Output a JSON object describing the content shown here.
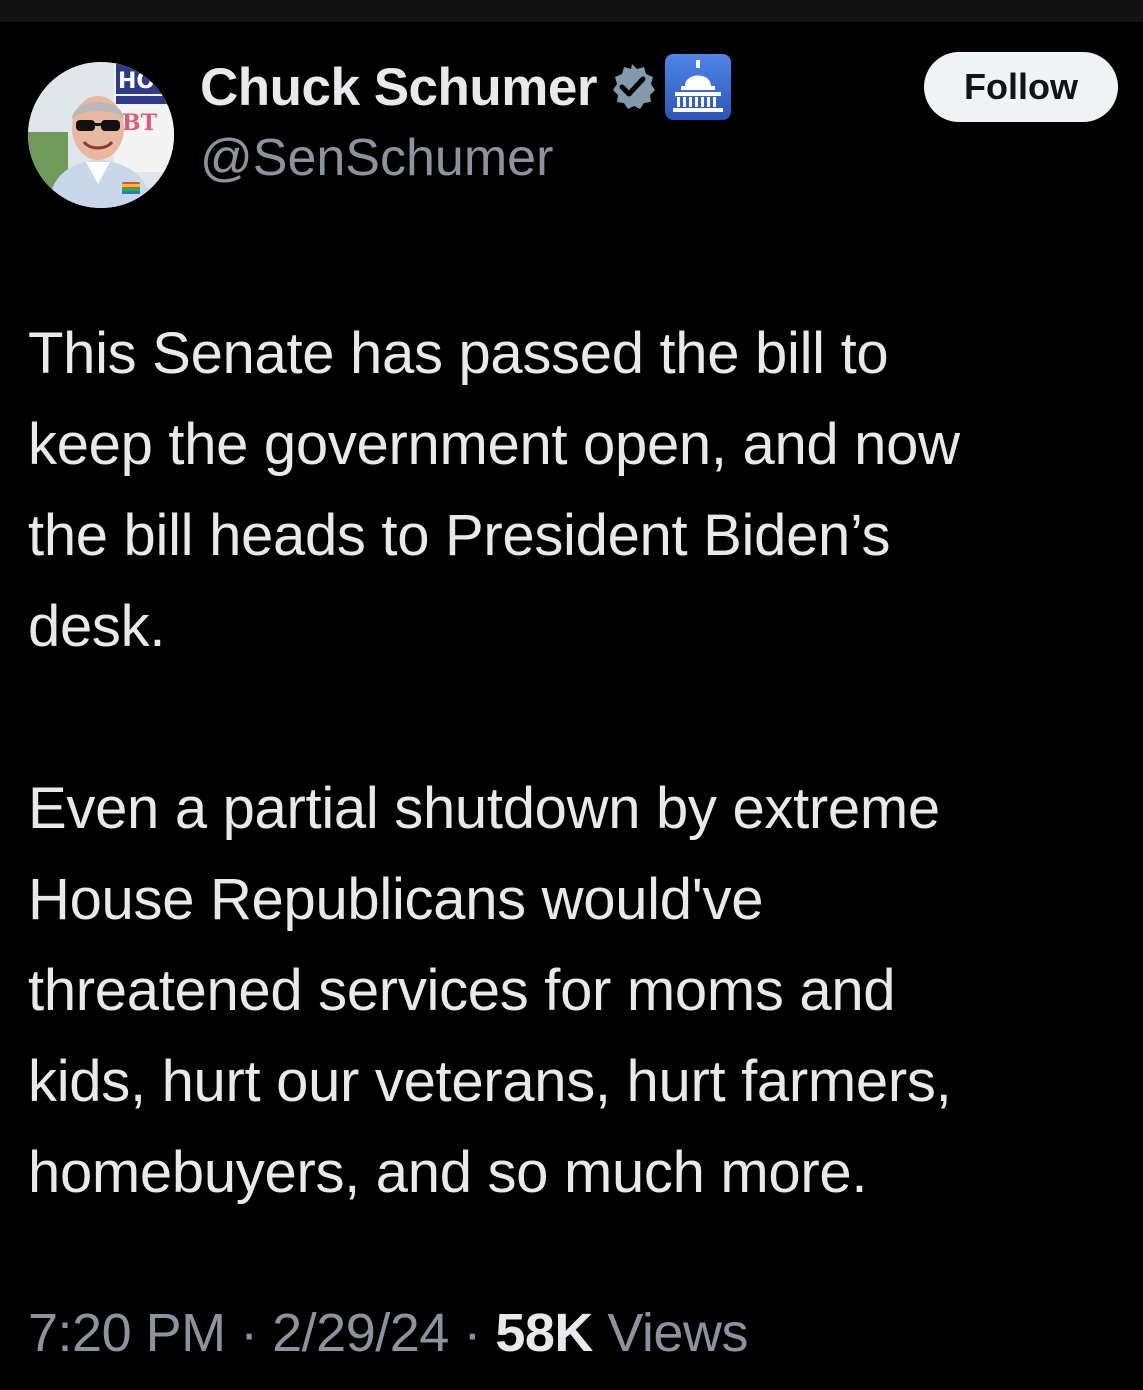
{
  "author": {
    "display_name": "Chuck Schumer",
    "handle": "@SenSchumer",
    "verified_icon": "verified-badge-icon",
    "affiliation_icon": "capitol-dome-icon",
    "avatar_sign_text": [
      "HO",
      "BT"
    ]
  },
  "actions": {
    "follow_label": "Follow"
  },
  "tweet": {
    "paragraphs": [
      "This Senate has passed the bill to\nkeep the government open, and now\nthe bill heads to President Biden’s\ndesk.",
      "Even a partial shutdown by extreme\nHouse Republicans would've\nthreatened services for moms and\nkids, hurt our veterans, hurt farmers,\nhomebuyers, and so much more."
    ]
  },
  "meta": {
    "time": "7:20 PM",
    "separator": "·",
    "date": "2/29/24",
    "views_count": "58K",
    "views_label": "Views"
  },
  "colors": {
    "background": "#000000",
    "text_primary": "#e7e9ea",
    "text_secondary": "#8b949e",
    "verified_badge": "#829aab",
    "affiliate_badge": "#3b6fd8",
    "follow_button_bg": "#eff3f4"
  }
}
